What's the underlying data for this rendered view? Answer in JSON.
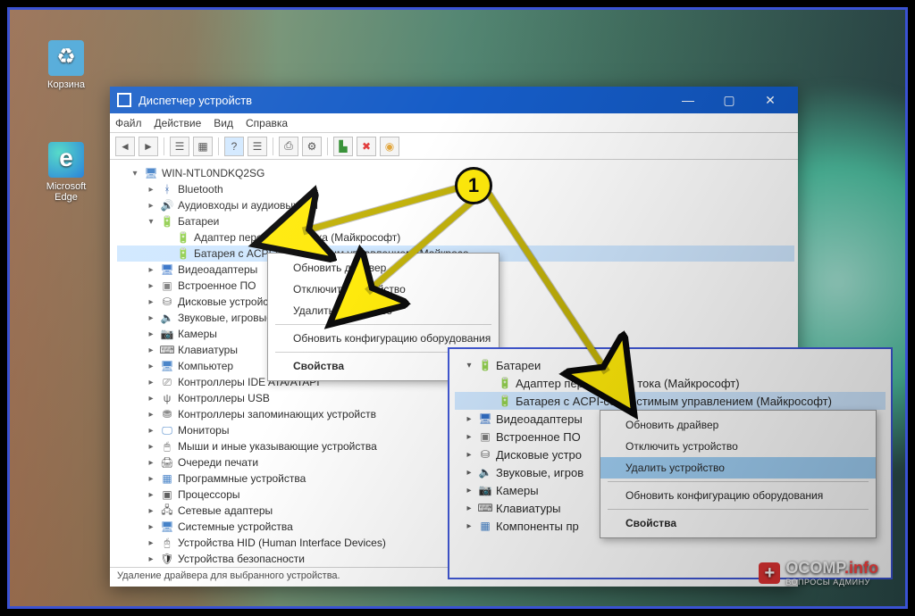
{
  "desktop": {
    "recycle_label": "Корзина",
    "edge_label": "Microsoft Edge"
  },
  "window": {
    "title": "Диспетчер устройств",
    "menu": {
      "file": "Файл",
      "action": "Действие",
      "view": "Вид",
      "help": "Справка"
    },
    "statusbar": "Удаление драйвера для выбранного устройства."
  },
  "tree": {
    "root": "WIN-NTL0NDKQ2SG",
    "bluetooth": "Bluetooth",
    "audio": "Аудиовходы и аудиовыходы",
    "batteries": "Батареи",
    "bat_adapter": "Адаптер переменного тока (Майкрософт)",
    "bat_acpi": "Батарея с ACPI-совместимым управлением (Майкрософт)",
    "bat_acpi_trunc": "Батарея с ACPI-совместимым управлением (Майкросо...",
    "video": "Видеоадаптеры",
    "firmware": "Встроенное ПО",
    "disks": "Дисковые устройства",
    "disks_trunc": "Дисковые устро",
    "sound": "Звуковые, игровые и видеоустройства",
    "sound_trunc": "Звуковые, игров",
    "cameras": "Камеры",
    "keyboards": "Клавиатуры",
    "components_trunc": "Компоненты пр",
    "computer": "Компьютер",
    "ide": "Контроллеры IDE ATA/ATAPI",
    "usb": "Контроллеры USB",
    "storage_ctrl": "Контроллеры запоминающих устройств",
    "monitors": "Мониторы",
    "mice": "Мыши и иные указывающие устройства",
    "print_queue": "Очереди печати",
    "software": "Программные устройства",
    "processors": "Процессоры",
    "network": "Сетевые адаптеры",
    "system": "Системные устройства",
    "hid": "Устройства HID (Human Interface Devices)",
    "security_trunc": "Устройства безопасности"
  },
  "ctx": {
    "update": "Обновить драйвер",
    "disable": "Отключить устройство",
    "uninstall": "Удалить устройство",
    "scan": "Обновить конфигурацию оборудования",
    "props": "Свойства"
  },
  "annotation": {
    "badge": "1"
  },
  "watermark": {
    "brand_a": "OCOMP",
    "brand_b": ".info",
    "tagline": "ВОПРОСЫ АДМИНУ"
  }
}
